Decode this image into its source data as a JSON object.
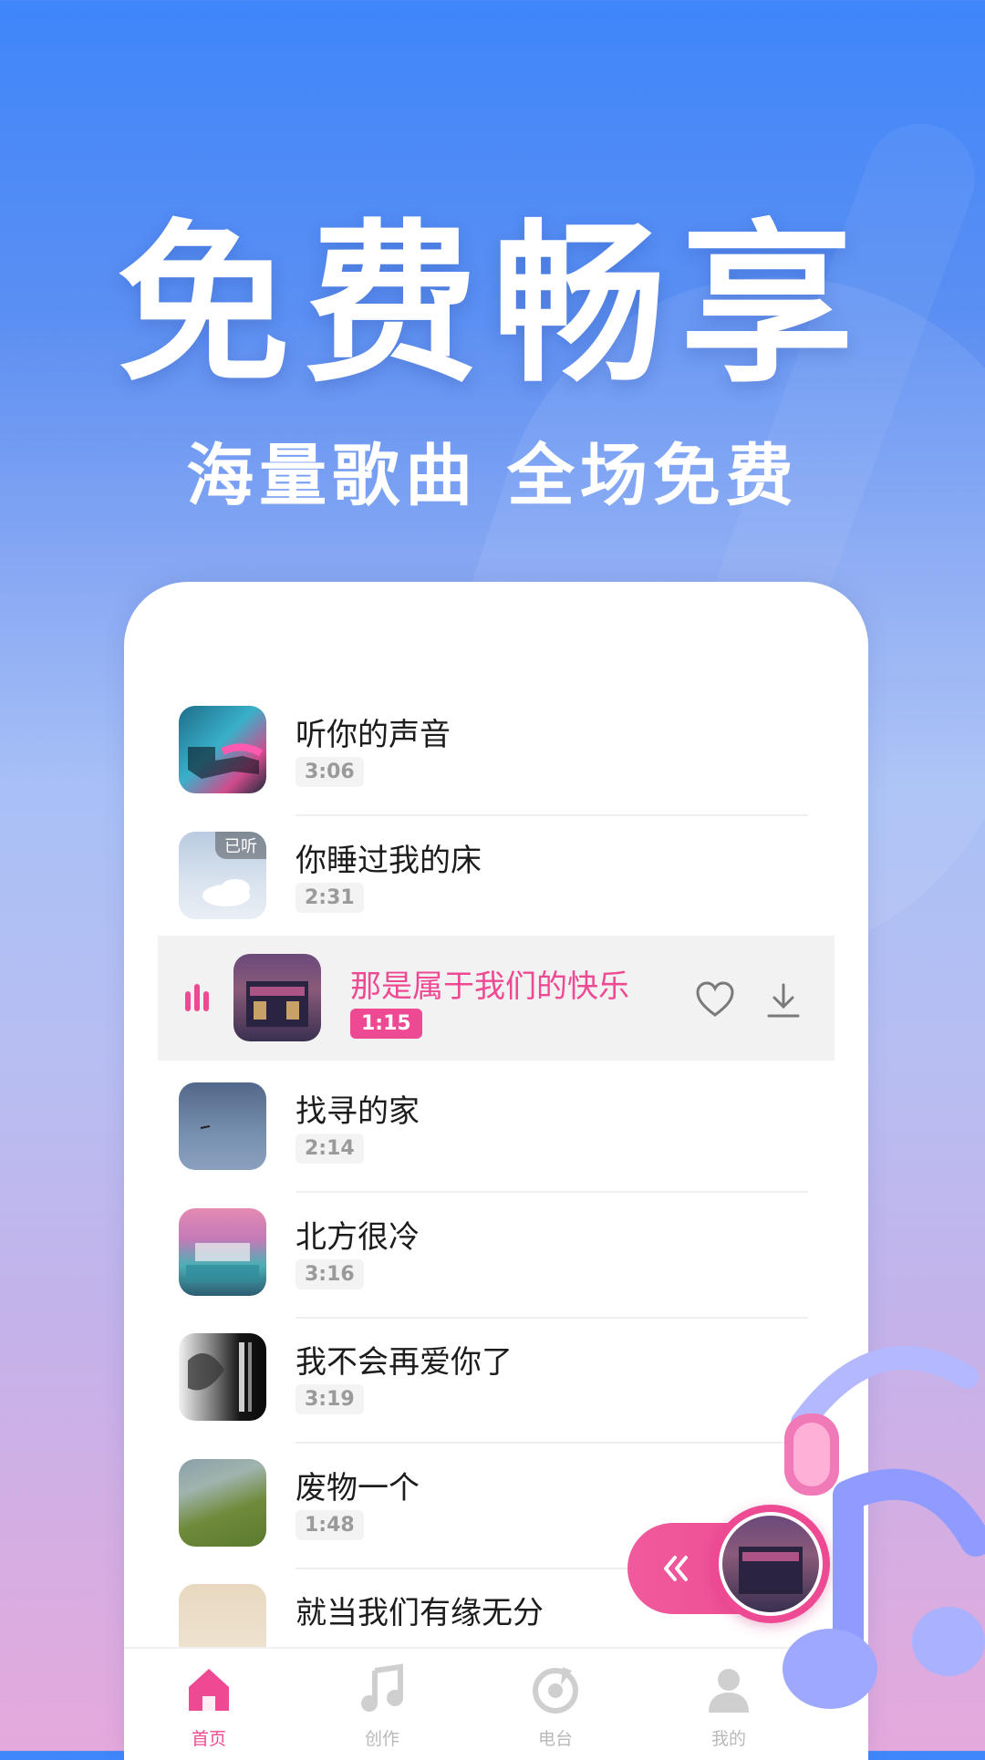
{
  "hero": {
    "headline": "免费畅享",
    "subline": "海量歌曲 全场免费"
  },
  "songs": [
    {
      "title": "听你的声音",
      "duration": "3:06"
    },
    {
      "title": "你睡过我的床",
      "duration": "2:31",
      "badge": "已听"
    },
    {
      "title": "找寻的家",
      "duration": "2:14"
    },
    {
      "title": "北方很冷",
      "duration": "3:16"
    },
    {
      "title": "我不会再爱你了",
      "duration": "3:19"
    },
    {
      "title": "废物一个",
      "duration": "1:48"
    },
    {
      "title": "就当我们有缘无分",
      "duration": ""
    }
  ],
  "now_playing": {
    "title": "那是属于我们的快乐",
    "duration": "1:15",
    "favorite_icon": "heart-icon",
    "download_icon": "download-icon"
  },
  "tabs": [
    {
      "label": "首页",
      "icon": "home-icon",
      "active": true
    },
    {
      "label": "创作",
      "icon": "music-note-icon",
      "active": false
    },
    {
      "label": "电台",
      "icon": "radio-icon",
      "active": false
    },
    {
      "label": "我的",
      "icon": "user-icon",
      "active": false
    }
  ],
  "colors": {
    "accent": "#ee4a93",
    "background_top": "#3f86fb",
    "background_bottom": "#e5a9dc"
  }
}
